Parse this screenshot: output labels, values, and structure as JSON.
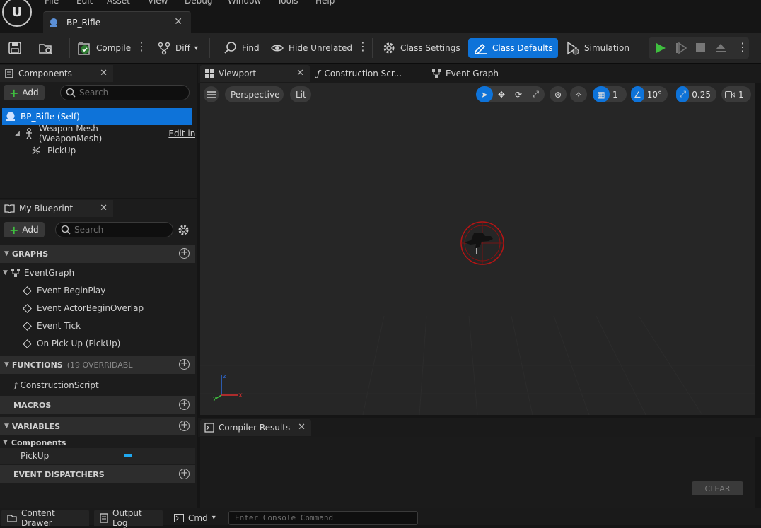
{
  "menu": [
    "File",
    "Edit",
    "Asset",
    "View",
    "Debug",
    "Window",
    "Tools",
    "Help"
  ],
  "document_tab": {
    "title": "BP_Rifle"
  },
  "toolbar": {
    "compile": "Compile",
    "diff": "Diff",
    "find": "Find",
    "hide_unrelated": "Hide Unrelated",
    "class_settings": "Class Settings",
    "class_defaults": "Class Defaults",
    "simulation": "Simulation"
  },
  "components_panel": {
    "tab": "Components",
    "add": "Add",
    "search_placeholder": "Search",
    "items": [
      {
        "label": "BP_Rifle (Self)"
      },
      {
        "label": "Weapon Mesh (WeaponMesh)",
        "link": "Edit in C++"
      },
      {
        "label": "PickUp"
      }
    ]
  },
  "my_blueprint": {
    "tab": "My Blueprint",
    "add": "Add",
    "search_placeholder": "Search",
    "graphs_header": "GRAPHS",
    "event_graph": "EventGraph",
    "events": [
      "Event BeginPlay",
      "Event ActorBeginOverlap",
      "Event Tick",
      "On Pick Up (PickUp)"
    ],
    "functions_header": "FUNCTIONS",
    "functions_sub": "(19 OVERRIDABL",
    "construction_script": "ConstructionScript",
    "macros_header": "MACROS",
    "variables_header": "VARIABLES",
    "components_group": "Components",
    "pickup_var": "PickUp",
    "dispatchers_header": "EVENT DISPATCHERS"
  },
  "editor_tabs": {
    "viewport": "Viewport",
    "construction": "Construction Scr...",
    "event_graph": "Event Graph"
  },
  "viewport_toolbar": {
    "perspective": "Perspective",
    "lit": "Lit",
    "grid_snap": "1",
    "rot_snap": "10°",
    "scale_snap": "0.25",
    "camera_speed": "1"
  },
  "compiler": {
    "tab": "Compiler Results",
    "clear": "CLEAR"
  },
  "statusbar": {
    "content_drawer": "Content Drawer",
    "output_log": "Output Log",
    "cmd": "Cmd",
    "console_placeholder": "Enter Console Command"
  },
  "colors": {
    "accent": "#0e73d9",
    "play": "#3fbf3f"
  }
}
